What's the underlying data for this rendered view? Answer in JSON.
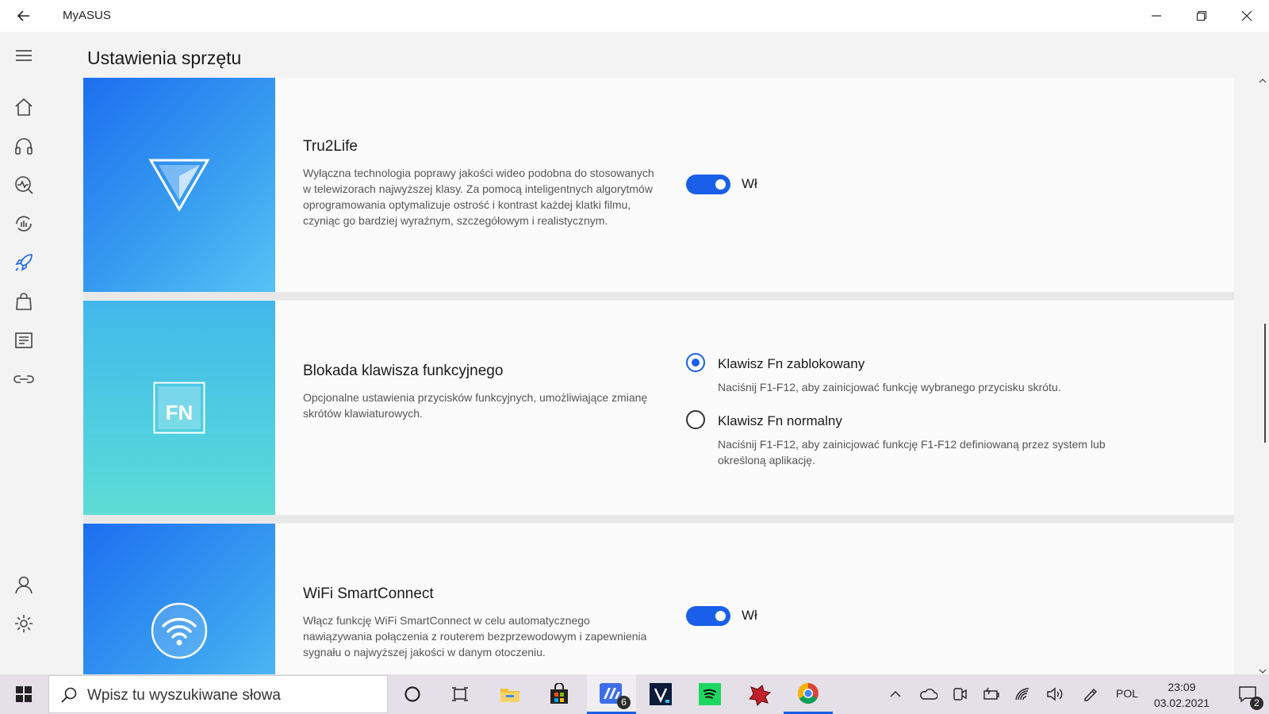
{
  "window": {
    "app_title": "MyASUS",
    "controls": [
      "minimize-icon",
      "restore-icon",
      "close-icon"
    ]
  },
  "header": {
    "page_title": "Ustawienia sprzętu"
  },
  "sidebar": {
    "items": [
      "home-icon",
      "headset-icon",
      "diagnostics-icon",
      "system-update-icon",
      "rocket-icon",
      "bag-icon",
      "news-icon",
      "link-icon",
      "user-icon",
      "gear-icon"
    ],
    "active_item": "rocket-icon",
    "accent_color": "#1a5fe8"
  },
  "cards": {
    "tru2life": {
      "title": "Tru2Life",
      "description": "Wyłączna technologia poprawy jakości wideo podobna do stosowanych w telewizorach najwyższej klasy. Za pomocą inteligentnych algorytmów oprogramowania optymalizuje ostrość i kontrast każdej klatki filmu, czyniąc go bardziej wyraźnym, szczegółowym i realistycznym.",
      "toggle_on": true,
      "toggle_label": "Wł"
    },
    "fn_lock": {
      "title": "Blokada klawisza funkcyjnego",
      "description": "Opcjonalne ustawienia przycisków funkcyjnych, umożliwiające zmianę skrótów klawiaturowych.",
      "icon_text": "FN",
      "options": [
        {
          "label": "Klawisz Fn zablokowany",
          "description": "Naciśnij F1-F12, aby zainicjować funkcję wybranego przycisku skrótu.",
          "selected": true
        },
        {
          "label": "Klawisz Fn normalny",
          "description": "Naciśnij F1-F12, aby zainicjować funkcję F1-F12 definiowaną przez system lub określoną aplikację.",
          "selected": false
        }
      ]
    },
    "wifi": {
      "title": "WiFi SmartConnect",
      "description": "Włącz funkcję WiFi SmartConnect w celu automatycznego nawiązywania połączenia z routerem bezprzewodowym i zapewnienia sygnału o najwyższej jakości w danym otoczeniu.",
      "toggle_on": true,
      "toggle_label": "Wł"
    }
  },
  "taskbar": {
    "search_placeholder": "Wpisz tu wyszukiwane słowa",
    "myasus_badge": "6",
    "language": "POL",
    "time": "23:09",
    "date": "03.02.2021",
    "notification_count": "2"
  }
}
